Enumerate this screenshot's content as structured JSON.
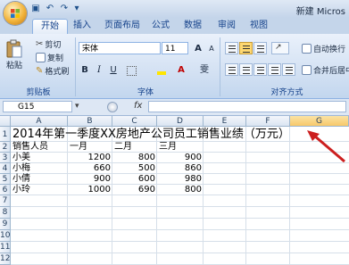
{
  "window": {
    "title": "新建 Micros"
  },
  "tabs": [
    "开始",
    "插入",
    "页面布局",
    "公式",
    "数据",
    "审阅",
    "视图"
  ],
  "clipboard": {
    "paste": "粘贴",
    "cut": "剪切",
    "copy": "复制",
    "format_painter": "格式刷",
    "label": "剪贴板"
  },
  "font": {
    "name": "宋体",
    "size": "11",
    "grow": "A",
    "shrink": "A",
    "bold": "B",
    "italic": "I",
    "underline": "U",
    "label": "字体",
    "font_color_icon": "A",
    "phonetic": "雯"
  },
  "alignment": {
    "wrap": "自动换行",
    "merge": "合并后居中",
    "label": "对齐方式"
  },
  "formula_bar": {
    "name_box": "G15",
    "fx": "fx",
    "value": ""
  },
  "columns": [
    "A",
    "B",
    "C",
    "D",
    "E",
    "F",
    "G"
  ],
  "rows": [
    "1",
    "2",
    "3",
    "4",
    "5",
    "6",
    "7",
    "8",
    "9",
    "10",
    "11",
    "12"
  ],
  "sheet": {
    "title": "2014年第一季度XX房地产公司员工销售业绩（万元）",
    "headers": [
      "销售人员",
      "一月",
      "二月",
      "三月"
    ],
    "data": [
      [
        "小美",
        "1200",
        "800",
        "900"
      ],
      [
        "小梅",
        "660",
        "500",
        "860"
      ],
      [
        "小倩",
        "900",
        "600",
        "980"
      ],
      [
        "小玲",
        "1000",
        "690",
        "800"
      ]
    ]
  },
  "colors": {
    "accent": "#15428b",
    "arrow": "#cc1f1f",
    "selected_column": "#f7c86a"
  }
}
